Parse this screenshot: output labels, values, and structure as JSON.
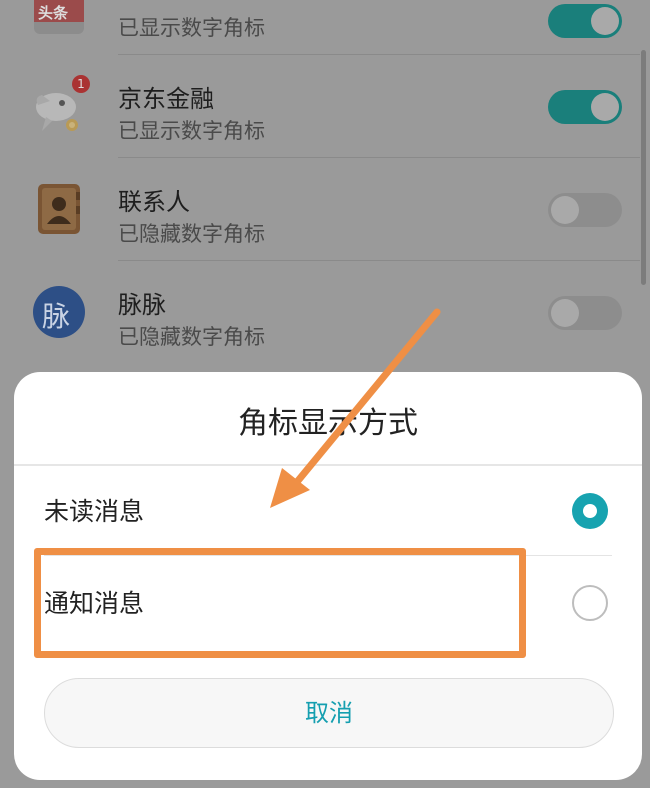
{
  "apps": [
    {
      "title": "",
      "subtitle": "已显示数字角标",
      "toggle": "on",
      "icon": "partial-app-icon"
    },
    {
      "title": "京东金融",
      "subtitle": "已显示数字角标",
      "toggle": "on",
      "icon": "jd-finance-icon",
      "badge": "1"
    },
    {
      "title": "联系人",
      "subtitle": "已隐藏数字角标",
      "toggle": "off",
      "icon": "contacts-icon"
    },
    {
      "title": "脉脉",
      "subtitle": "已隐藏数字角标",
      "toggle": "off",
      "icon": "maimai-icon",
      "icon_text": "脉"
    }
  ],
  "partial_icon_text": "头条",
  "dialog": {
    "title": "角标显示方式",
    "options": [
      {
        "label": "未读消息",
        "selected": true
      },
      {
        "label": "通知消息",
        "selected": false
      }
    ],
    "cancel_label": "取消"
  },
  "colors": {
    "accent": "#17a3b0",
    "toggle_on": "#1a7f7b",
    "annotation": "#ef8f45"
  }
}
